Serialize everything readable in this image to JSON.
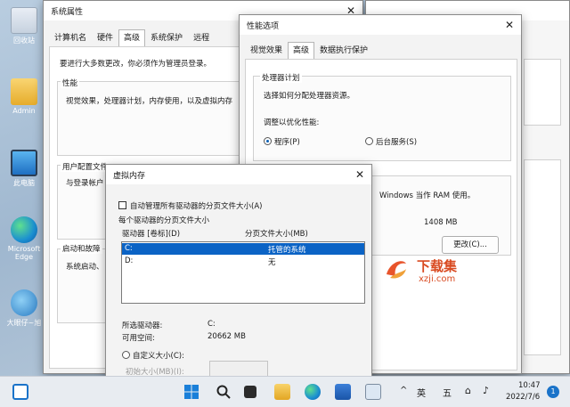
{
  "desktop": {
    "icons": [
      "回收站",
      "Admin",
      "此电脑",
      "Microsoft Edge",
      "大眼仔~旭"
    ]
  },
  "sysprops": {
    "title": "系统属性",
    "tabs": [
      "计算机名",
      "硬件",
      "高级",
      "系统保护",
      "远程"
    ],
    "admin_note": "要进行大多数更改，你必须作为管理员登录。",
    "perf_label": "性能",
    "perf_desc": "视觉效果，处理器计划，内存使用，以及虚拟内存",
    "profile_label": "用户配置文件",
    "profile_desc": "与登录帐户",
    "startup_label": "启动和故障",
    "startup_desc": "系统启动、"
  },
  "perfopts": {
    "title": "性能选项",
    "tabs": [
      "视觉效果",
      "高级",
      "数据执行保护"
    ],
    "sched_label": "处理器计划",
    "sched_desc": "选择如何分配处理器资源。",
    "optimize_label": "调整以优化性能:",
    "radio_programs": "程序(P)",
    "radio_services": "后台服务(S)",
    "ram_text": "Windows 当作 RAM 使用。",
    "vm_size": "1408 MB",
    "change_button": "更改(C)..."
  },
  "vm": {
    "title": "虚拟内存",
    "auto_manage": "自动管理所有驱动器的分页文件大小(A)",
    "per_drive": "每个驱动器的分页文件大小",
    "col_drive": "驱动器 [卷标](D)",
    "col_size": "分页文件大小(MB)",
    "rows": [
      {
        "drive": "C:",
        "size": "托管的系统"
      },
      {
        "drive": "D:",
        "size": "无"
      }
    ],
    "selected_label": "所选驱动器:",
    "selected_value": "C:",
    "space_label": "可用空间:",
    "space_value": "20662 MB",
    "custom_size": "自定义大小(C):",
    "initial_size": "初始大小(MB)(I):"
  },
  "watermark": {
    "name": "下载集",
    "url": "xzji.com"
  },
  "taskbar": {
    "ime1": "英",
    "ime2": "五",
    "time": "10:47",
    "date": "2022/7/6",
    "badge": "1"
  },
  "colors": {
    "accent": "#0a5fb4",
    "selection": "#0b63c5"
  }
}
